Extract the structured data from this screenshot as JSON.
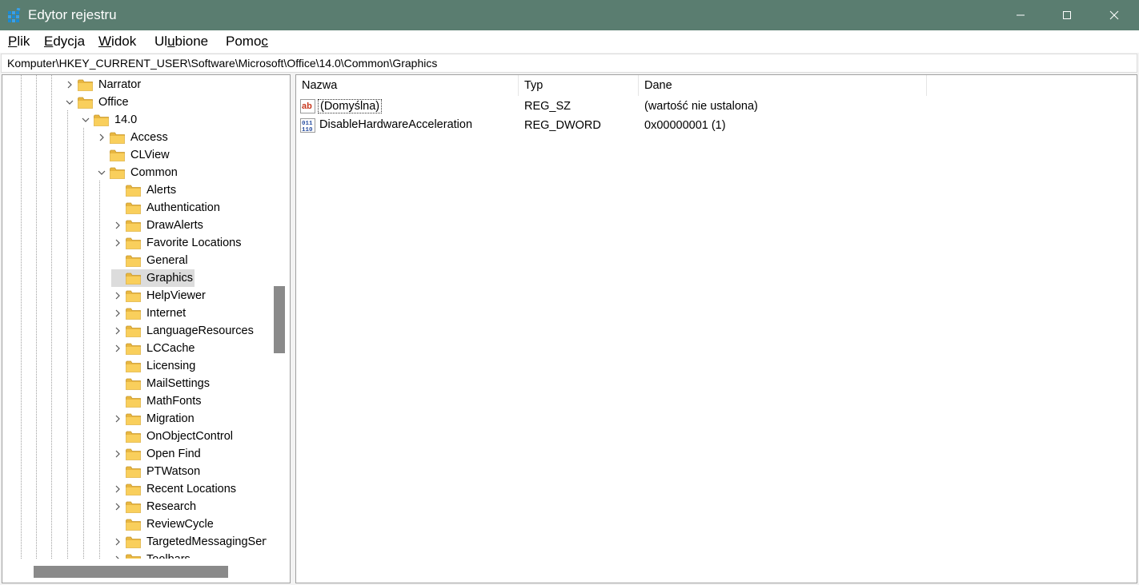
{
  "window": {
    "title": "Edytor rejestru",
    "title_bar_color": "#5a7d70"
  },
  "menu": [
    {
      "pre": "",
      "u": "P",
      "post": "lik"
    },
    {
      "pre": "",
      "u": "E",
      "post": "dycja"
    },
    {
      "pre": "",
      "u": "W",
      "post": "idok"
    },
    {
      "pre": "Ul",
      "u": "u",
      "post": "bione"
    },
    {
      "pre": "Pomo",
      "u": "c",
      "post": ""
    }
  ],
  "address": "Komputer\\HKEY_CURRENT_USER\\Software\\Microsoft\\Office\\14.0\\Common\\Graphics",
  "tree": [
    {
      "label": "Narrator",
      "depth": 0,
      "expander": "collapsed"
    },
    {
      "label": "Office",
      "depth": 0,
      "expander": "expanded"
    },
    {
      "label": "14.0",
      "depth": 1,
      "expander": "expanded"
    },
    {
      "label": "Access",
      "depth": 2,
      "expander": "collapsed"
    },
    {
      "label": "CLView",
      "depth": 2,
      "expander": "none"
    },
    {
      "label": "Common",
      "depth": 2,
      "expander": "expanded"
    },
    {
      "label": "Alerts",
      "depth": 3,
      "expander": "none"
    },
    {
      "label": "Authentication",
      "depth": 3,
      "expander": "none"
    },
    {
      "label": "DrawAlerts",
      "depth": 3,
      "expander": "collapsed"
    },
    {
      "label": "Favorite Locations",
      "depth": 3,
      "expander": "collapsed"
    },
    {
      "label": "General",
      "depth": 3,
      "expander": "none"
    },
    {
      "label": "Graphics",
      "depth": 3,
      "expander": "none",
      "selected": true
    },
    {
      "label": "HelpViewer",
      "depth": 3,
      "expander": "collapsed"
    },
    {
      "label": "Internet",
      "depth": 3,
      "expander": "collapsed"
    },
    {
      "label": "LanguageResources",
      "depth": 3,
      "expander": "collapsed"
    },
    {
      "label": "LCCache",
      "depth": 3,
      "expander": "collapsed"
    },
    {
      "label": "Licensing",
      "depth": 3,
      "expander": "none"
    },
    {
      "label": "MailSettings",
      "depth": 3,
      "expander": "none"
    },
    {
      "label": "MathFonts",
      "depth": 3,
      "expander": "none"
    },
    {
      "label": "Migration",
      "depth": 3,
      "expander": "collapsed"
    },
    {
      "label": "OnObjectControl",
      "depth": 3,
      "expander": "none"
    },
    {
      "label": "Open Find",
      "depth": 3,
      "expander": "collapsed"
    },
    {
      "label": "PTWatson",
      "depth": 3,
      "expander": "none"
    },
    {
      "label": "Recent Locations",
      "depth": 3,
      "expander": "collapsed"
    },
    {
      "label": "Research",
      "depth": 3,
      "expander": "collapsed"
    },
    {
      "label": "ReviewCycle",
      "depth": 3,
      "expander": "none"
    },
    {
      "label": "TargetedMessagingServ",
      "depth": 3,
      "expander": "collapsed"
    },
    {
      "label": "Toolbars",
      "depth": 3,
      "expander": "collapsed"
    }
  ],
  "columns": {
    "name": "Nazwa",
    "type": "Typ",
    "data": "Dane"
  },
  "values": [
    {
      "name": "(Domyślna)",
      "type": "REG_SZ",
      "data": "(wartość nie ustalona)",
      "icon": "string-value-icon"
    },
    {
      "name": "DisableHardwareAcceleration",
      "type": "REG_DWORD",
      "data": "0x00000001 (1)",
      "icon": "binary-value-icon"
    }
  ]
}
